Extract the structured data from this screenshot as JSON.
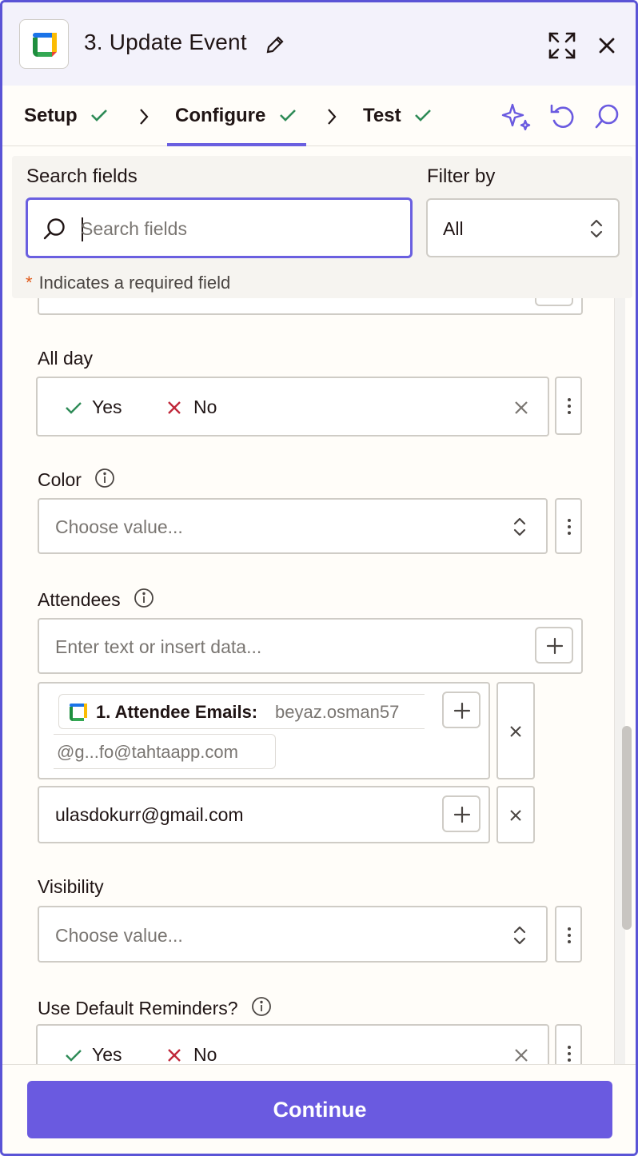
{
  "header": {
    "title": "3. Update Event",
    "app_icon": "google-calendar-icon"
  },
  "steps": [
    {
      "label": "Setup",
      "done": true
    },
    {
      "label": "Configure",
      "done": true,
      "active": true
    },
    {
      "label": "Test",
      "done": true
    }
  ],
  "search": {
    "label": "Search fields",
    "placeholder": "Search fields",
    "value": "",
    "filter_label": "Filter by",
    "filter_value": "All",
    "required_note": "Indicates a required field",
    "required_star": "*"
  },
  "fields": {
    "all_day": {
      "label": "All day",
      "yes": "Yes",
      "no": "No"
    },
    "color": {
      "label": "Color",
      "placeholder": "Choose value..."
    },
    "attendees": {
      "label": "Attendees",
      "placeholder": "Enter text or insert data...",
      "mapped": {
        "name": "1. Attendee Emails:",
        "value": "beyaz.osman57",
        "value_cont": "@g...fo@tahtaapp.com"
      },
      "item": "ulasdokurr@gmail.com"
    },
    "visibility": {
      "label": "Visibility",
      "placeholder": "Choose value..."
    },
    "reminders": {
      "label": "Use Default Reminders?",
      "yes": "Yes",
      "no": "No"
    }
  },
  "footer": {
    "continue_label": "Continue"
  },
  "colors": {
    "accent": "#6a5ae0",
    "check": "#2e8b57",
    "cross": "#c0283a",
    "brand_border": "#5a54d6"
  }
}
